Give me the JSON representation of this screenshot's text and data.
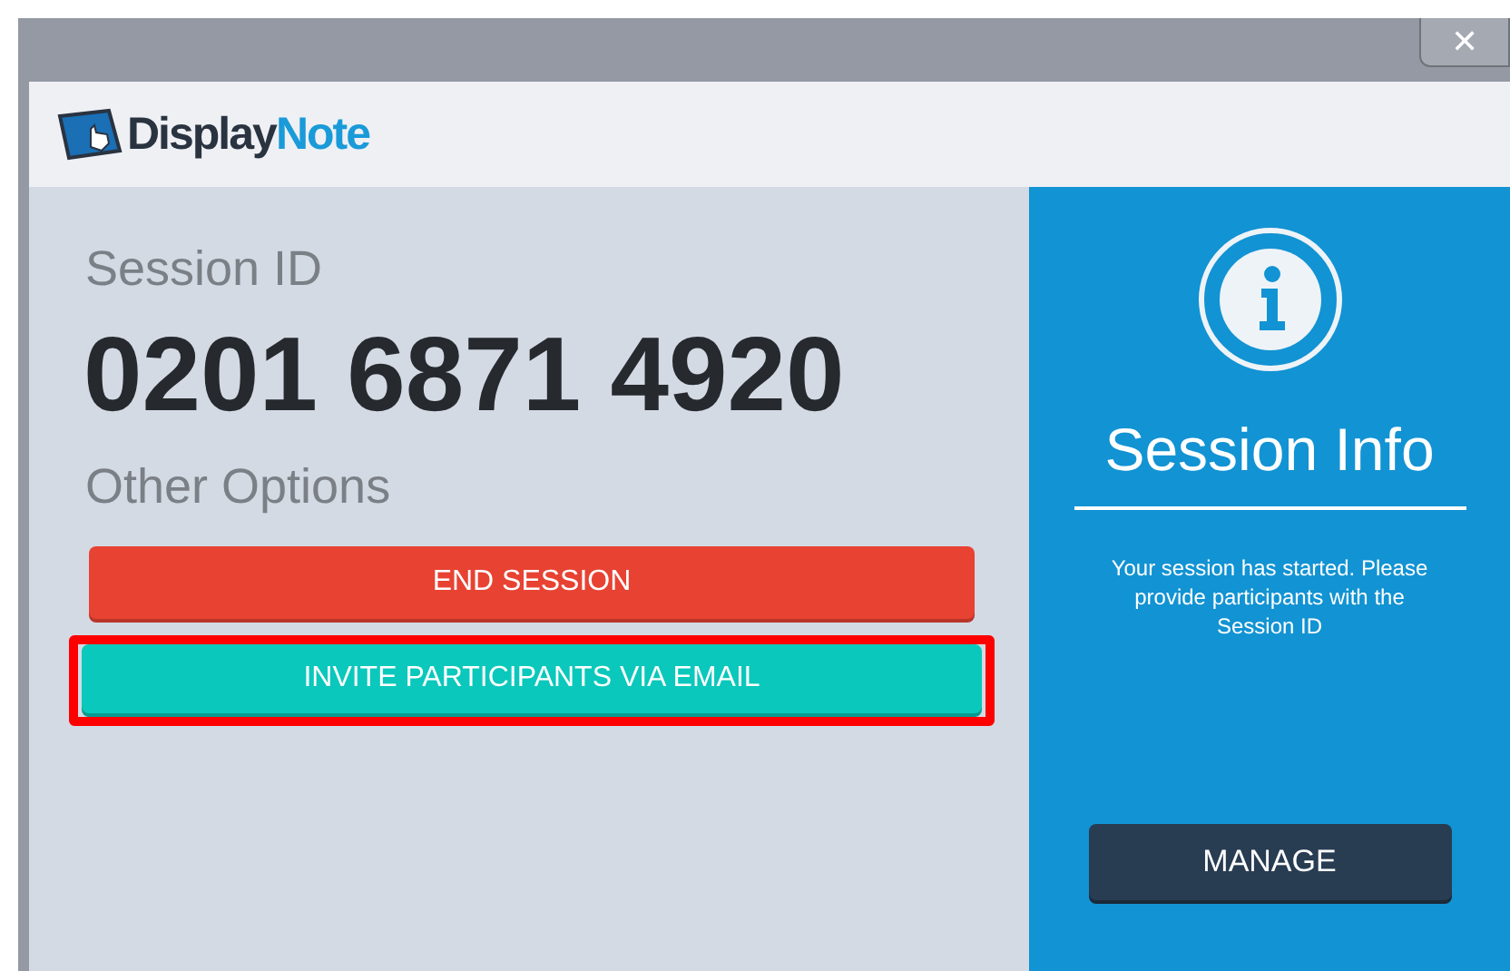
{
  "window": {
    "close": "✕"
  },
  "header": {
    "brand": "Display",
    "brand_accent": "Note"
  },
  "session": {
    "label": "Session ID",
    "id": "0201 6871 4920"
  },
  "options": {
    "heading": "Other Options",
    "buttons": [
      {
        "label": "END SESSION",
        "kind": "danger",
        "highlighted": false
      },
      {
        "label": "INVITE PARTICIPANTS VIA EMAIL",
        "kind": "accent",
        "highlighted": true
      }
    ]
  },
  "info": {
    "title": "Session Info",
    "text": "Your session has started. Please provide participants with the Session ID",
    "button": "MANAGE"
  }
}
